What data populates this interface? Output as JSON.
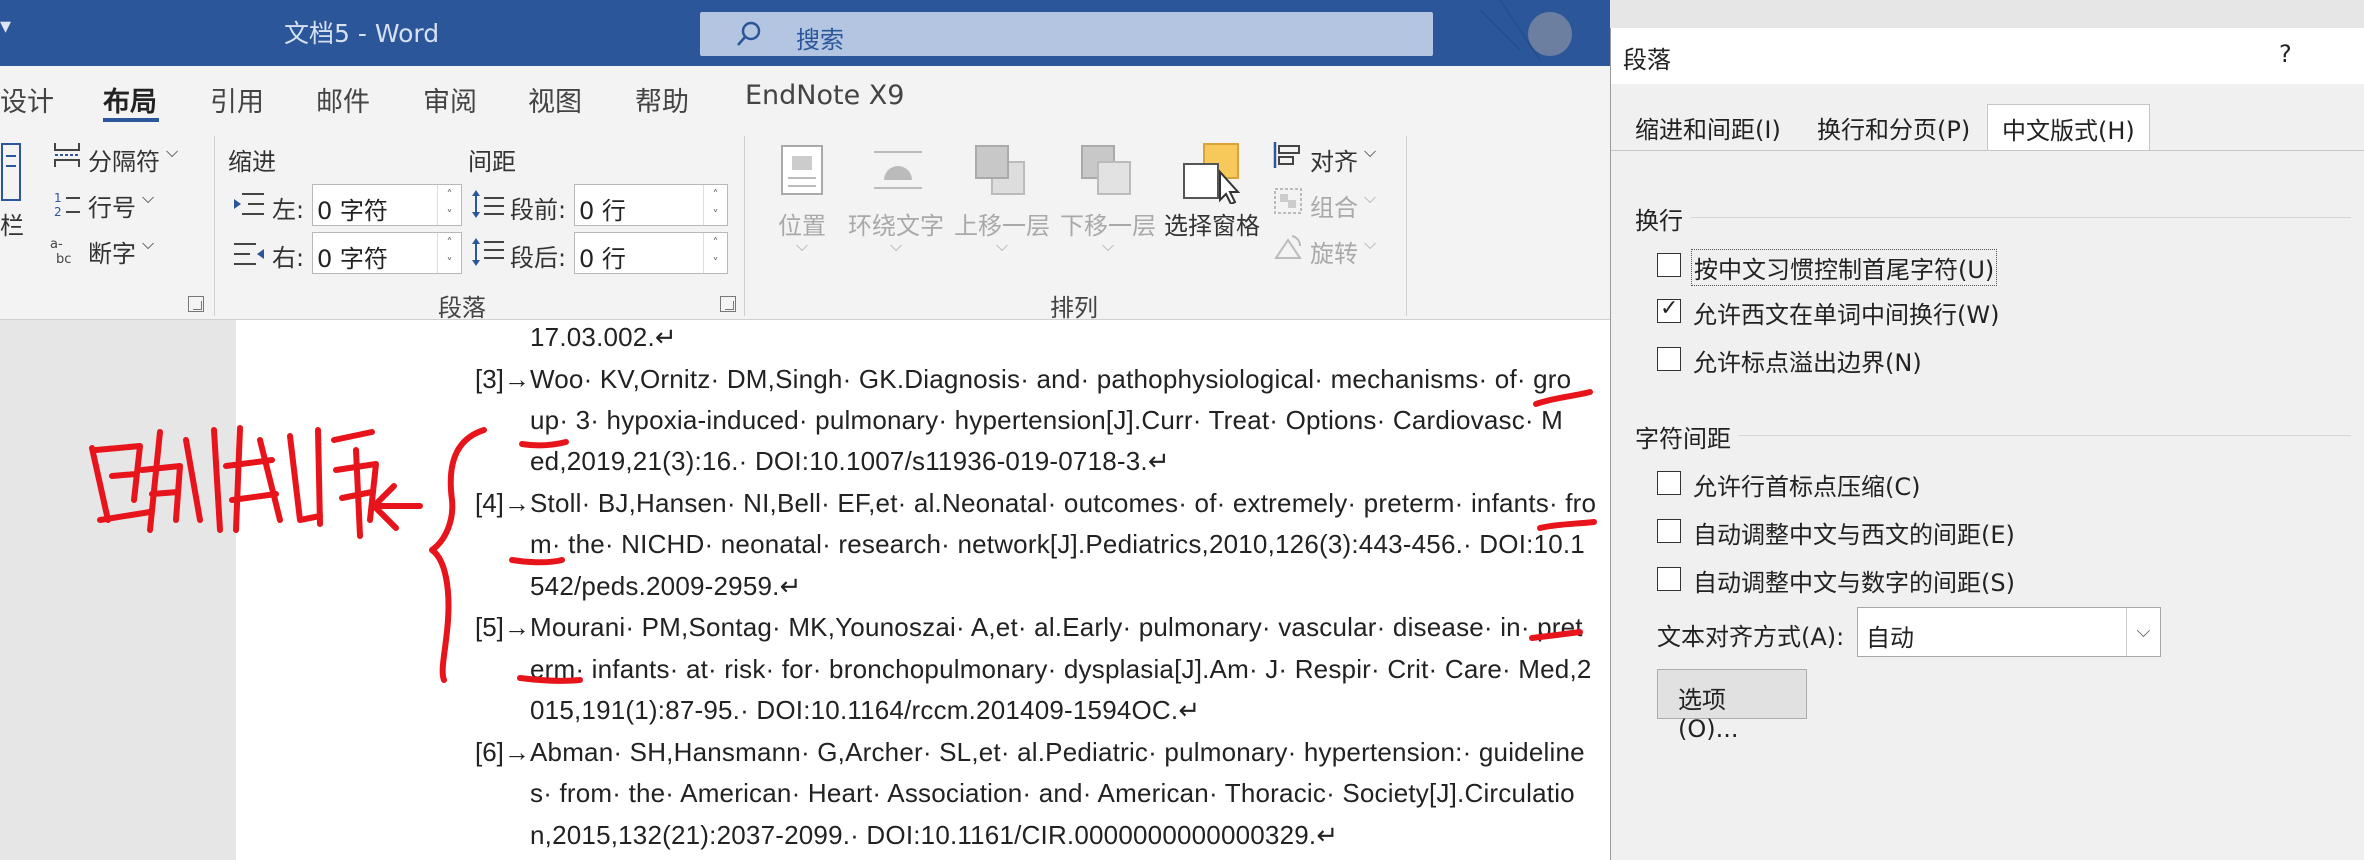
{
  "titlebar": {
    "left_glyph": "▾",
    "doc_title": "文档5  -  Word",
    "search_placeholder": "搜索",
    "bg_color": "#2b579a"
  },
  "tabs": [
    {
      "label": "设计",
      "active": false
    },
    {
      "label": "布局",
      "active": true
    },
    {
      "label": "引用",
      "active": false
    },
    {
      "label": "邮件",
      "active": false
    },
    {
      "label": "审阅",
      "active": false
    },
    {
      "label": "视图",
      "active": false
    },
    {
      "label": "帮助",
      "active": false
    },
    {
      "label": "EndNote X9",
      "active": false
    }
  ],
  "ribbon": {
    "page_setup": {
      "breaks": "分隔符",
      "line_numbers": "行号",
      "hyphenation": "断字",
      "edge_text": "栏"
    },
    "paragraph": {
      "indent_label": "缩进",
      "spacing_label": "间距",
      "left_label": "左:",
      "left_value": "0 字符",
      "right_label": "右:",
      "right_value": "0 字符",
      "before_label": "段前:",
      "before_value": "0 行",
      "after_label": "段后:",
      "after_value": "0 行",
      "group_name": "段落"
    },
    "arrange": {
      "position": "位置",
      "wrap_text": "环绕文字",
      "bring_forward": "上移一层",
      "send_backward": "下移一层",
      "selection_pane": "选择窗格",
      "align": "对齐",
      "group": "组合",
      "rotate": "旋转",
      "group_name": "排列"
    }
  },
  "document": {
    "lines": [
      {
        "num": "",
        "text": "17.03.002.↵"
      },
      {
        "num": "[3]→",
        "text": "Woo· KV,Ornitz· DM,Singh· GK.Diagnosis· and· pathophysiological· mechanisms· of· gro"
      },
      {
        "num": "",
        "text": "up· 3· hypoxia-induced· pulmonary· hypertension[J].Curr· Treat· Options· Cardiovasc· M"
      },
      {
        "num": "",
        "text": "ed,2019,21(3):16.· DOI:10.1007/s11936-019-0718-3.↵"
      },
      {
        "num": "[4]→",
        "text": "Stoll· BJ,Hansen· NI,Bell· EF,et· al.Neonatal· outcomes· of· extremely· preterm· infants· fro"
      },
      {
        "num": "",
        "text": "m· the· NICHD· neonatal· research· network[J].Pediatrics,2010,126(3):443-456.· DOI:10.1"
      },
      {
        "num": "",
        "text": "542/peds.2009-2959.↵"
      },
      {
        "num": "[5]→",
        "text": "Mourani· PM,Sontag· MK,Younoszai· A,et· al.Early· pulmonary· vascular· disease· in· pret"
      },
      {
        "num": "",
        "text": "erm· infants· at· risk· for· bronchopulmonary· dysplasia[J].Am· J· Respir· Crit· Care· Med,2"
      },
      {
        "num": "",
        "text": "015,191(1):87-95.· DOI:10.1164/rccm.201409-1594OC.↵"
      },
      {
        "num": "[6]→",
        "text": "Abman· SH,Hansmann· G,Archer· SL,et· al.Pediatric· pulmonary· hypertension:· guideline"
      },
      {
        "num": "",
        "text": "s· from· the· American· Heart· Association· and· American· Thoracic· Society[J].Circulatio"
      },
      {
        "num": "",
        "text": "n,2015,132(21):2037-2099.· DOI:10.1161/CIR.0000000000000329.↵"
      }
    ]
  },
  "dialog": {
    "title": "段落",
    "help": "?",
    "tabs": [
      {
        "label": "缩进和间距(I)",
        "active": false
      },
      {
        "label": "换行和分页(P)",
        "active": false
      },
      {
        "label": "中文版式(H)",
        "active": true
      }
    ],
    "line_break_section": "换行",
    "line_break_options": [
      {
        "label": "按中文习惯控制首尾字符(U)",
        "checked": false
      },
      {
        "label": "允许西文在单词中间换行(W)",
        "checked": true
      },
      {
        "label": "允许标点溢出边界(N)",
        "checked": false
      }
    ],
    "spacing_section": "字符间距",
    "spacing_options": [
      {
        "label": "允许行首标点压缩(C)",
        "checked": false
      },
      {
        "label": "自动调整中文与西文的间距(E)",
        "checked": false
      },
      {
        "label": "自动调整中文与数字的间距(S)",
        "checked": false
      }
    ],
    "align_label": "文本对齐方式(A):",
    "align_value": "自动",
    "options_button": "选项(O)..."
  },
  "colors": {
    "accent": "#2b579a",
    "annotation_red": "#e8141c"
  }
}
